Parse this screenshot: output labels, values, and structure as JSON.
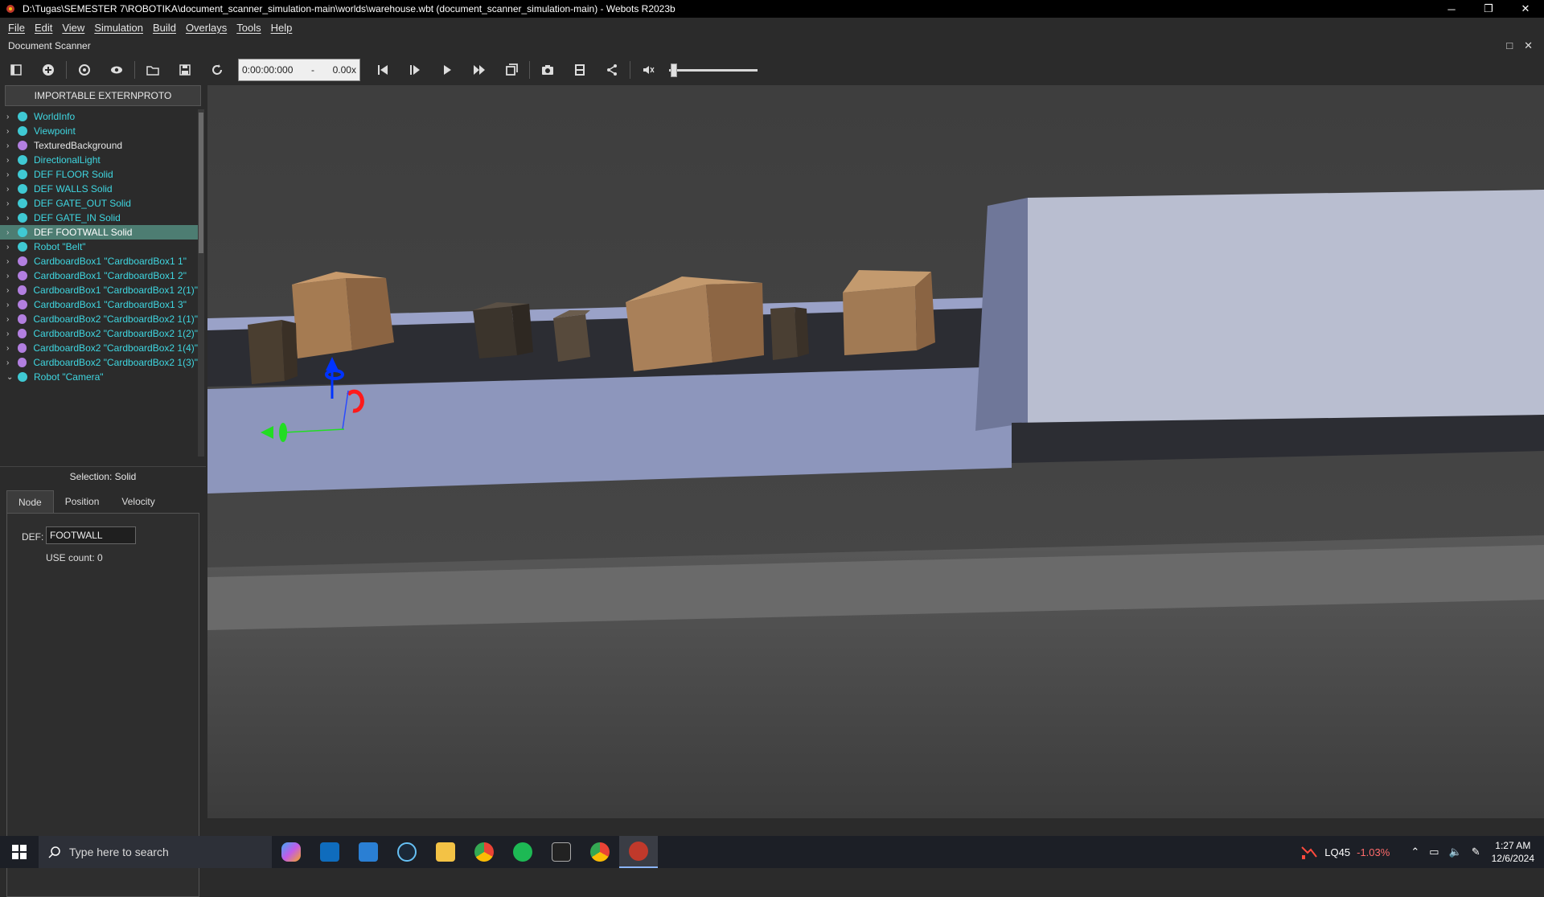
{
  "window": {
    "title": "D:\\Tugas\\SEMESTER 7\\ROBOTIKA\\document_scanner_simulation-main\\worlds\\warehouse.wbt (document_scanner_simulation-main) - Webots R2023b",
    "controls": [
      "─",
      "❐",
      "✕"
    ]
  },
  "menu": [
    "File",
    "Edit",
    "View",
    "Simulation",
    "Build",
    "Overlays",
    "Tools",
    "Help"
  ],
  "dock": {
    "title": "Document Scanner"
  },
  "toolbar": {
    "time": "0:00:00:000",
    "dash": "-",
    "speed": "0.00x",
    "volume_level": 0.0
  },
  "scene_tree": {
    "header": "IMPORTABLE EXTERNPROTO",
    "nodes": [
      {
        "label": "WorldInfo",
        "color": "#3fc9d3",
        "text_color": "#3fd6e0",
        "expanded": false
      },
      {
        "label": "Viewpoint",
        "color": "#3fc9d3",
        "text_color": "#3fd6e0",
        "expanded": false
      },
      {
        "label": "TexturedBackground",
        "color": "#b27fe0",
        "text_color": "#e6e6e6",
        "expanded": false
      },
      {
        "label": "DirectionalLight",
        "color": "#3fc9d3",
        "text_color": "#3fd6e0",
        "expanded": false
      },
      {
        "label": "DEF FLOOR Solid",
        "color": "#3fc9d3",
        "text_color": "#3fd6e0",
        "expanded": false
      },
      {
        "label": "DEF WALLS Solid",
        "color": "#3fc9d3",
        "text_color": "#3fd6e0",
        "expanded": false
      },
      {
        "label": "DEF GATE_OUT Solid",
        "color": "#3fc9d3",
        "text_color": "#3fd6e0",
        "expanded": false
      },
      {
        "label": "DEF GATE_IN Solid",
        "color": "#3fc9d3",
        "text_color": "#3fd6e0",
        "expanded": false
      },
      {
        "label": "DEF FOOTWALL Solid",
        "color": "#3fc9d3",
        "text_color": "#ffffff",
        "expanded": false,
        "selected": true
      },
      {
        "label": "Robot \"Belt\"",
        "color": "#3fc9d3",
        "text_color": "#3fd6e0",
        "expanded": false
      },
      {
        "label": "CardboardBox1 \"CardboardBox1 1\"",
        "color": "#b27fe0",
        "text_color": "#3fd6e0",
        "expanded": false
      },
      {
        "label": "CardboardBox1 \"CardboardBox1 2\"",
        "color": "#b27fe0",
        "text_color": "#3fd6e0",
        "expanded": false
      },
      {
        "label": "CardboardBox1 \"CardboardBox1 2(1)\"",
        "color": "#b27fe0",
        "text_color": "#3fd6e0",
        "expanded": false
      },
      {
        "label": "CardboardBox1 \"CardboardBox1 3\"",
        "color": "#b27fe0",
        "text_color": "#3fd6e0",
        "expanded": false
      },
      {
        "label": "CardboardBox2 \"CardboardBox2 1(1)\"",
        "color": "#b27fe0",
        "text_color": "#3fd6e0",
        "expanded": false
      },
      {
        "label": "CardboardBox2 \"CardboardBox2 1(2)\"",
        "color": "#b27fe0",
        "text_color": "#3fd6e0",
        "expanded": false
      },
      {
        "label": "CardboardBox2 \"CardboardBox2 1(4)\"",
        "color": "#b27fe0",
        "text_color": "#3fd6e0",
        "expanded": false
      },
      {
        "label": "CardboardBox2 \"CardboardBox2 1(3)\"",
        "color": "#b27fe0",
        "text_color": "#3fd6e0",
        "expanded": false
      },
      {
        "label": "Robot \"Camera\"",
        "color": "#3fc9d3",
        "text_color": "#3fd6e0",
        "expanded": true
      }
    ]
  },
  "selection": {
    "label": "Selection: Solid",
    "tabs": [
      "Node",
      "Position",
      "Velocity"
    ],
    "def_label": "DEF:",
    "def_value": "FOOTWALL",
    "use_count": "USE count: 0"
  },
  "taskbar": {
    "search_placeholder": "Type here to search",
    "stock_symbol": "LQ45",
    "stock_change": "-1.03%",
    "time": "1:27 AM",
    "date": "12/6/2024"
  }
}
